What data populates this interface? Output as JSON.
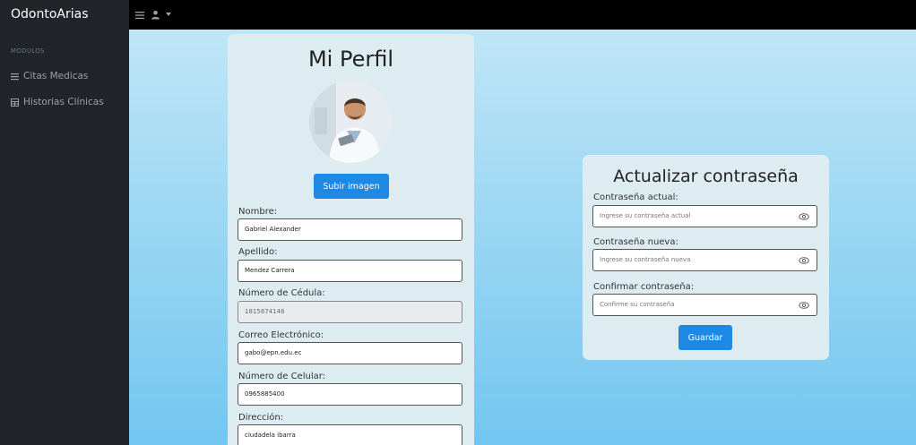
{
  "app": {
    "brand": "OdontoArias"
  },
  "topbar": {
    "menu_icon": "hamburger-icon",
    "user_icon": "user-icon",
    "caret_icon": "caret-down-icon"
  },
  "sidebar": {
    "heading": "MODULOS",
    "items": [
      {
        "label": "Citas Medicas",
        "icon": "list-icon"
      },
      {
        "label": "Historias Clínicas",
        "icon": "table-icon"
      }
    ]
  },
  "profile": {
    "title": "Mi Perfil",
    "upload_button": "Subir imagen",
    "fields": [
      {
        "label": "Nombre:",
        "value": "Gabriel Alexander",
        "disabled": false
      },
      {
        "label": "Apellido:",
        "value": "Mendez Carrera",
        "disabled": false
      },
      {
        "label": "Número de Cédula:",
        "value": "1815674146",
        "disabled": true
      },
      {
        "label": "Correo Electrónico:",
        "value": "gabo@epn.edu.ec",
        "disabled": false
      },
      {
        "label": "Número de Celular:",
        "value": "0965885400",
        "disabled": false
      },
      {
        "label": "Dirección:",
        "value": "ciudadela ibarra",
        "disabled": false
      }
    ]
  },
  "password": {
    "title": "Actualizar contraseña",
    "fields": [
      {
        "label": "Contraseña actual:",
        "placeholder": "Ingrese su contraseña actual"
      },
      {
        "label": "Contraseña nueva:",
        "placeholder": "Ingrese su contraseña nueva"
      },
      {
        "label": "Confirmar contraseña:",
        "placeholder": "Confirme su contraseña"
      }
    ],
    "save_button": "Guardar"
  },
  "colors": {
    "accent": "#1e88e5",
    "sidebar": "#212529",
    "card": "#dcecf1"
  }
}
